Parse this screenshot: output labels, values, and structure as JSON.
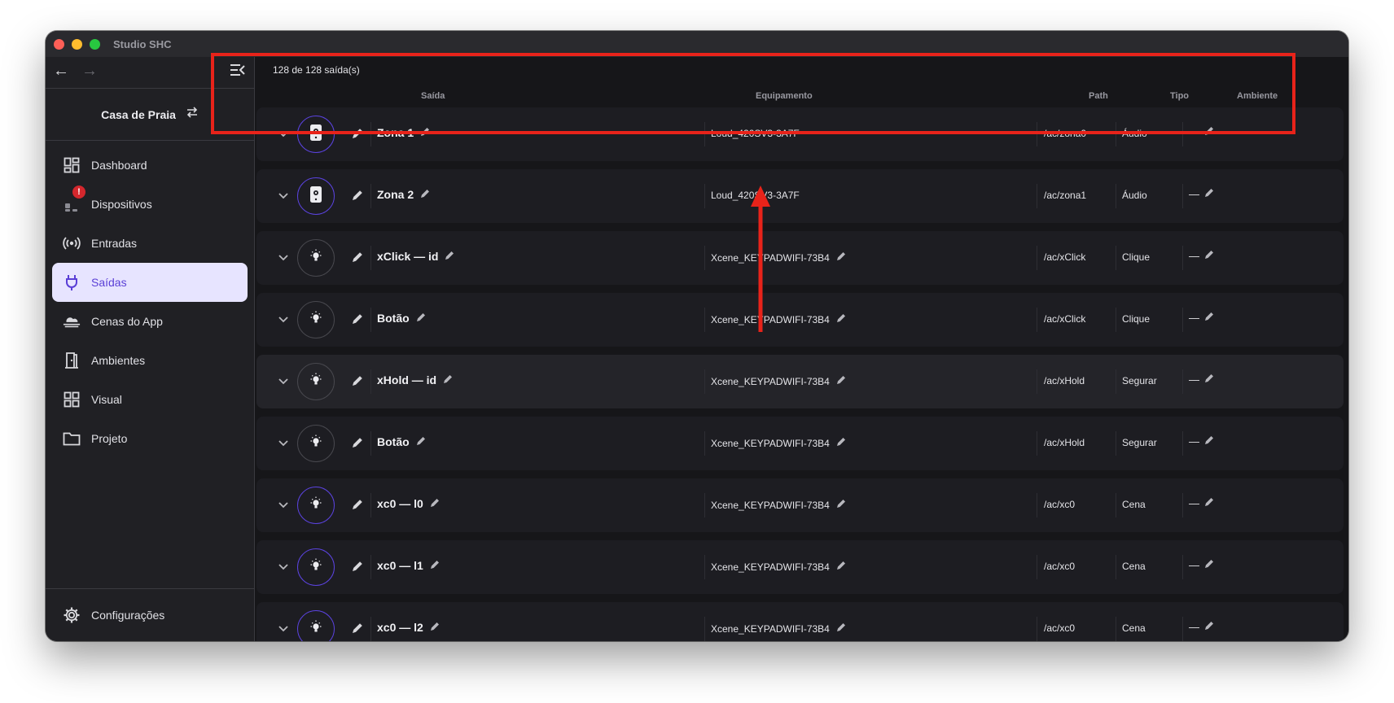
{
  "window": {
    "title": "Studio SHC"
  },
  "sidebar": {
    "project_name": "Casa de Praia",
    "items": [
      {
        "label": "Dashboard",
        "icon": "dashboard-icon"
      },
      {
        "label": "Dispositivos",
        "icon": "devices-icon",
        "badge": "!"
      },
      {
        "label": "Entradas",
        "icon": "broadcast-icon"
      },
      {
        "label": "Saídas",
        "icon": "plug-icon",
        "active": true
      },
      {
        "label": "Cenas do App",
        "icon": "cloud-icon"
      },
      {
        "label": "Ambientes",
        "icon": "door-icon"
      },
      {
        "label": "Visual",
        "icon": "grid-icon"
      },
      {
        "label": "Projeto",
        "icon": "folder-icon"
      }
    ],
    "settings_label": "Configurações"
  },
  "main": {
    "count_text": "128 de 128 saída(s)",
    "columns": {
      "saida": "Saída",
      "equipamento": "Equipamento",
      "path": "Path",
      "tipo": "Tipo",
      "ambiente": "Ambiente"
    },
    "rows": [
      {
        "name": "Zona 1",
        "equipment": "Loud_420SV3-3A7F",
        "path": "/ac/zona0",
        "type": "Áudio",
        "ambiente": "—",
        "icon": "speaker-icon",
        "equip_editable": false
      },
      {
        "name": "Zona 2",
        "equipment": "Loud_420SV3-3A7F",
        "path": "/ac/zona1",
        "type": "Áudio",
        "ambiente": "—",
        "icon": "speaker-icon",
        "equip_editable": false
      },
      {
        "name": "xClick — id",
        "equipment": "Xcene_KEYPADWIFI-73B4",
        "path": "/ac/xClick",
        "type": "Clique",
        "ambiente": "—",
        "icon": "bulb-icon",
        "equip_editable": true
      },
      {
        "name": "Botão",
        "equipment": "Xcene_KEYPADWIFI-73B4",
        "path": "/ac/xClick",
        "type": "Clique",
        "ambiente": "—",
        "icon": "bulb-icon",
        "equip_editable": true
      },
      {
        "name": "xHold — id",
        "equipment": "Xcene_KEYPADWIFI-73B4",
        "path": "/ac/xHold",
        "type": "Segurar",
        "ambiente": "—",
        "icon": "bulb-icon",
        "equip_editable": true
      },
      {
        "name": "Botão",
        "equipment": "Xcene_KEYPADWIFI-73B4",
        "path": "/ac/xHold",
        "type": "Segurar",
        "ambiente": "—",
        "icon": "bulb-icon",
        "equip_editable": true
      },
      {
        "name": "xc0 — l0",
        "equipment": "Xcene_KEYPADWIFI-73B4",
        "path": "/ac/xc0",
        "type": "Cena",
        "ambiente": "—",
        "icon": "bulb-icon",
        "equip_editable": true
      },
      {
        "name": "xc0 — l1",
        "equipment": "Xcene_KEYPADWIFI-73B4",
        "path": "/ac/xc0",
        "type": "Cena",
        "ambiente": "—",
        "icon": "bulb-icon",
        "equip_editable": true
      },
      {
        "name": "xc0 — l2",
        "equipment": "Xcene_KEYPADWIFI-73B4",
        "path": "/ac/xc0",
        "type": "Cena",
        "ambiente": "—",
        "icon": "bulb-icon",
        "equip_editable": true
      }
    ]
  },
  "colors": {
    "accent": "#5b43e0",
    "active_bg": "#e7e4ff",
    "annotation": "#e8231a",
    "badge": "#d4272d"
  }
}
